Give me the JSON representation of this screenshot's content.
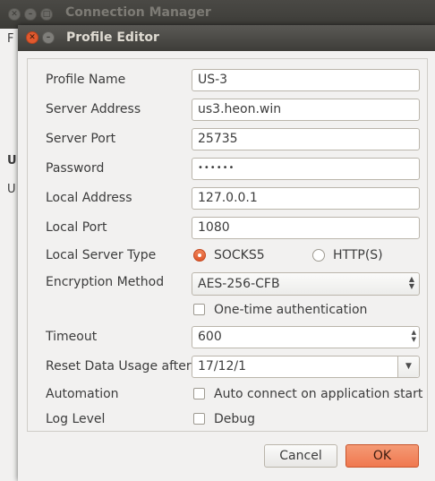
{
  "background_window": {
    "title": "Connection Manager",
    "fragments": [
      "F",
      "U",
      "U"
    ]
  },
  "dialog": {
    "title": "Profile Editor",
    "fields": {
      "profile_name": {
        "label": "Profile Name",
        "value": "US-3"
      },
      "server_address": {
        "label": "Server Address",
        "value": "us3.heon.win"
      },
      "server_port": {
        "label": "Server Port",
        "value": "25735"
      },
      "password": {
        "label": "Password",
        "value": "••••••"
      },
      "local_address": {
        "label": "Local Address",
        "value": "127.0.0.1"
      },
      "local_port": {
        "label": "Local Port",
        "value": "1080"
      },
      "local_server_type": {
        "label": "Local Server Type",
        "options": [
          "SOCKS5",
          "HTTP(S)"
        ],
        "selected": "SOCKS5"
      },
      "encryption_method": {
        "label": "Encryption Method",
        "value": "AES-256-CFB"
      },
      "one_time_auth": {
        "label": "One-time authentication",
        "checked": false
      },
      "timeout": {
        "label": "Timeout",
        "value": "600"
      },
      "reset_data_usage_after": {
        "label": "Reset Data Usage after",
        "value": "17/12/1"
      },
      "automation": {
        "label": "Automation",
        "checkbox_label": "Auto connect on application start",
        "checked": false
      },
      "log_level": {
        "label": "Log Level",
        "checkbox_label": "Debug",
        "checked": false
      }
    },
    "buttons": {
      "cancel": "Cancel",
      "ok": "OK"
    }
  },
  "colors": {
    "accent": "#f0784f",
    "radio_selected": "#e0582c",
    "titlebar": "#3c3b37"
  }
}
